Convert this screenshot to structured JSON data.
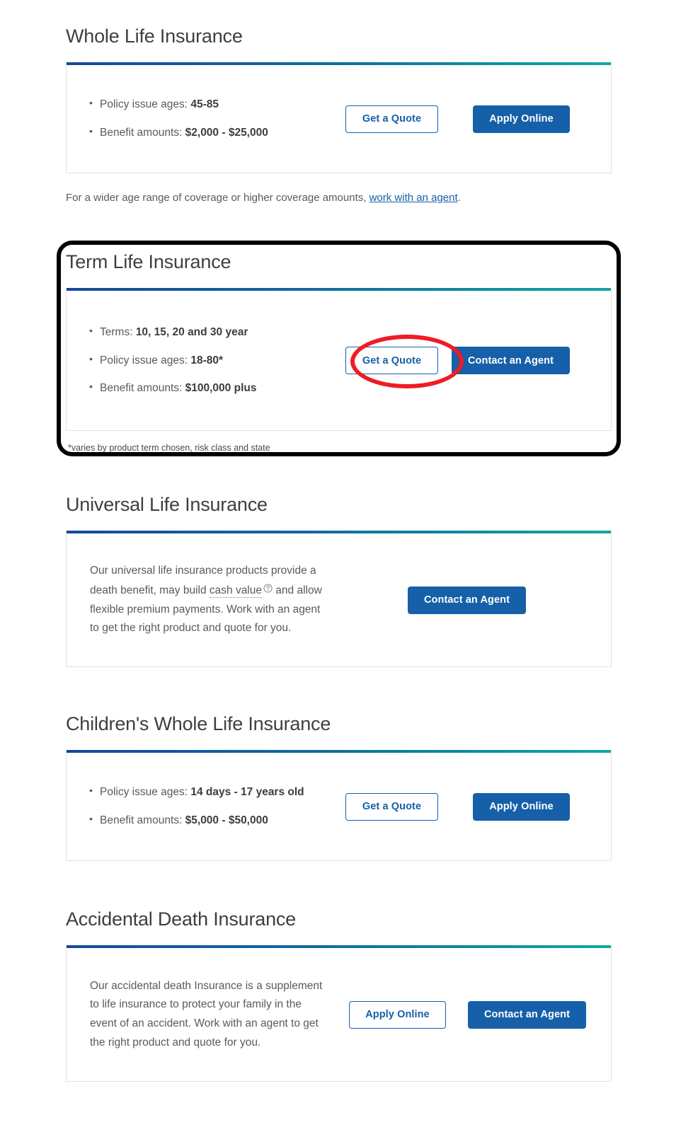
{
  "sections": [
    {
      "id": "whole-life",
      "title": "Whole Life Insurance",
      "bullets": [
        {
          "label": "Policy issue ages:",
          "value": "45-85"
        },
        {
          "label": "Benefit amounts:",
          "value": "$2,000 - $25,000"
        }
      ],
      "buttons": [
        {
          "label": "Get a Quote",
          "style": "outline"
        },
        {
          "label": "Apply Online",
          "style": "solid"
        }
      ],
      "note_prefix": "For a wider age range of coverage or higher coverage amounts, ",
      "note_link": "work with an agent",
      "note_suffix": "."
    },
    {
      "id": "term-life",
      "title": "Term Life Insurance",
      "bullets": [
        {
          "label": "Terms:",
          "value": "10, 15, 20 and 30 year"
        },
        {
          "label": "Policy issue ages:",
          "value": "18-80*"
        },
        {
          "label": "Benefit amounts:",
          "value": "$100,000 plus"
        }
      ],
      "buttons": [
        {
          "label": "Get a Quote",
          "style": "outline"
        },
        {
          "label": "Contact an Agent",
          "style": "solid"
        }
      ],
      "footnote": "*varies by product term chosen, risk class and state"
    },
    {
      "id": "universal-life",
      "title": "Universal Life Insurance",
      "paragraph_part1": "Our universal life insurance products provide a death benefit, may build ",
      "paragraph_term": "cash value",
      "paragraph_part2": " and allow flexible premium payments. Work with an agent to get the right product and quote for you.",
      "help_icon": "question-circle-icon",
      "buttons": [
        {
          "label": "Contact an Agent",
          "style": "solid"
        }
      ]
    },
    {
      "id": "childrens-whole-life",
      "title": "Children's Whole Life Insurance",
      "bullets": [
        {
          "label": "Policy issue ages:",
          "value": "14 days - 17 years old"
        },
        {
          "label": "Benefit amounts:",
          "value": "$5,000 - $50,000"
        }
      ],
      "buttons": [
        {
          "label": "Get a Quote",
          "style": "outline"
        },
        {
          "label": "Apply Online",
          "style": "solid"
        }
      ]
    },
    {
      "id": "accidental-death",
      "title": "Accidental Death Insurance",
      "paragraph": "Our accidental death Insurance is a supplement to life insurance to protect your family in the event of an accident. Work with an agent to get the right product and quote for you.",
      "buttons": [
        {
          "label": "Apply Online",
          "style": "outline"
        },
        {
          "label": "Contact an Agent",
          "style": "solid"
        }
      ]
    }
  ],
  "annotations": {
    "highlight_box_target": "term-life-section",
    "highlight_ellipse_target": "term-life-get-a-quote-button",
    "box_color": "#000000",
    "ellipse_color": "#ee1c25"
  },
  "theme": {
    "accent_blue": "#1560a8",
    "bar_gradient_start": "#15489a",
    "bar_gradient_end": "#11a7a2",
    "title_color": "#3f3f3f",
    "body_text_color": "#5a5a5a"
  }
}
